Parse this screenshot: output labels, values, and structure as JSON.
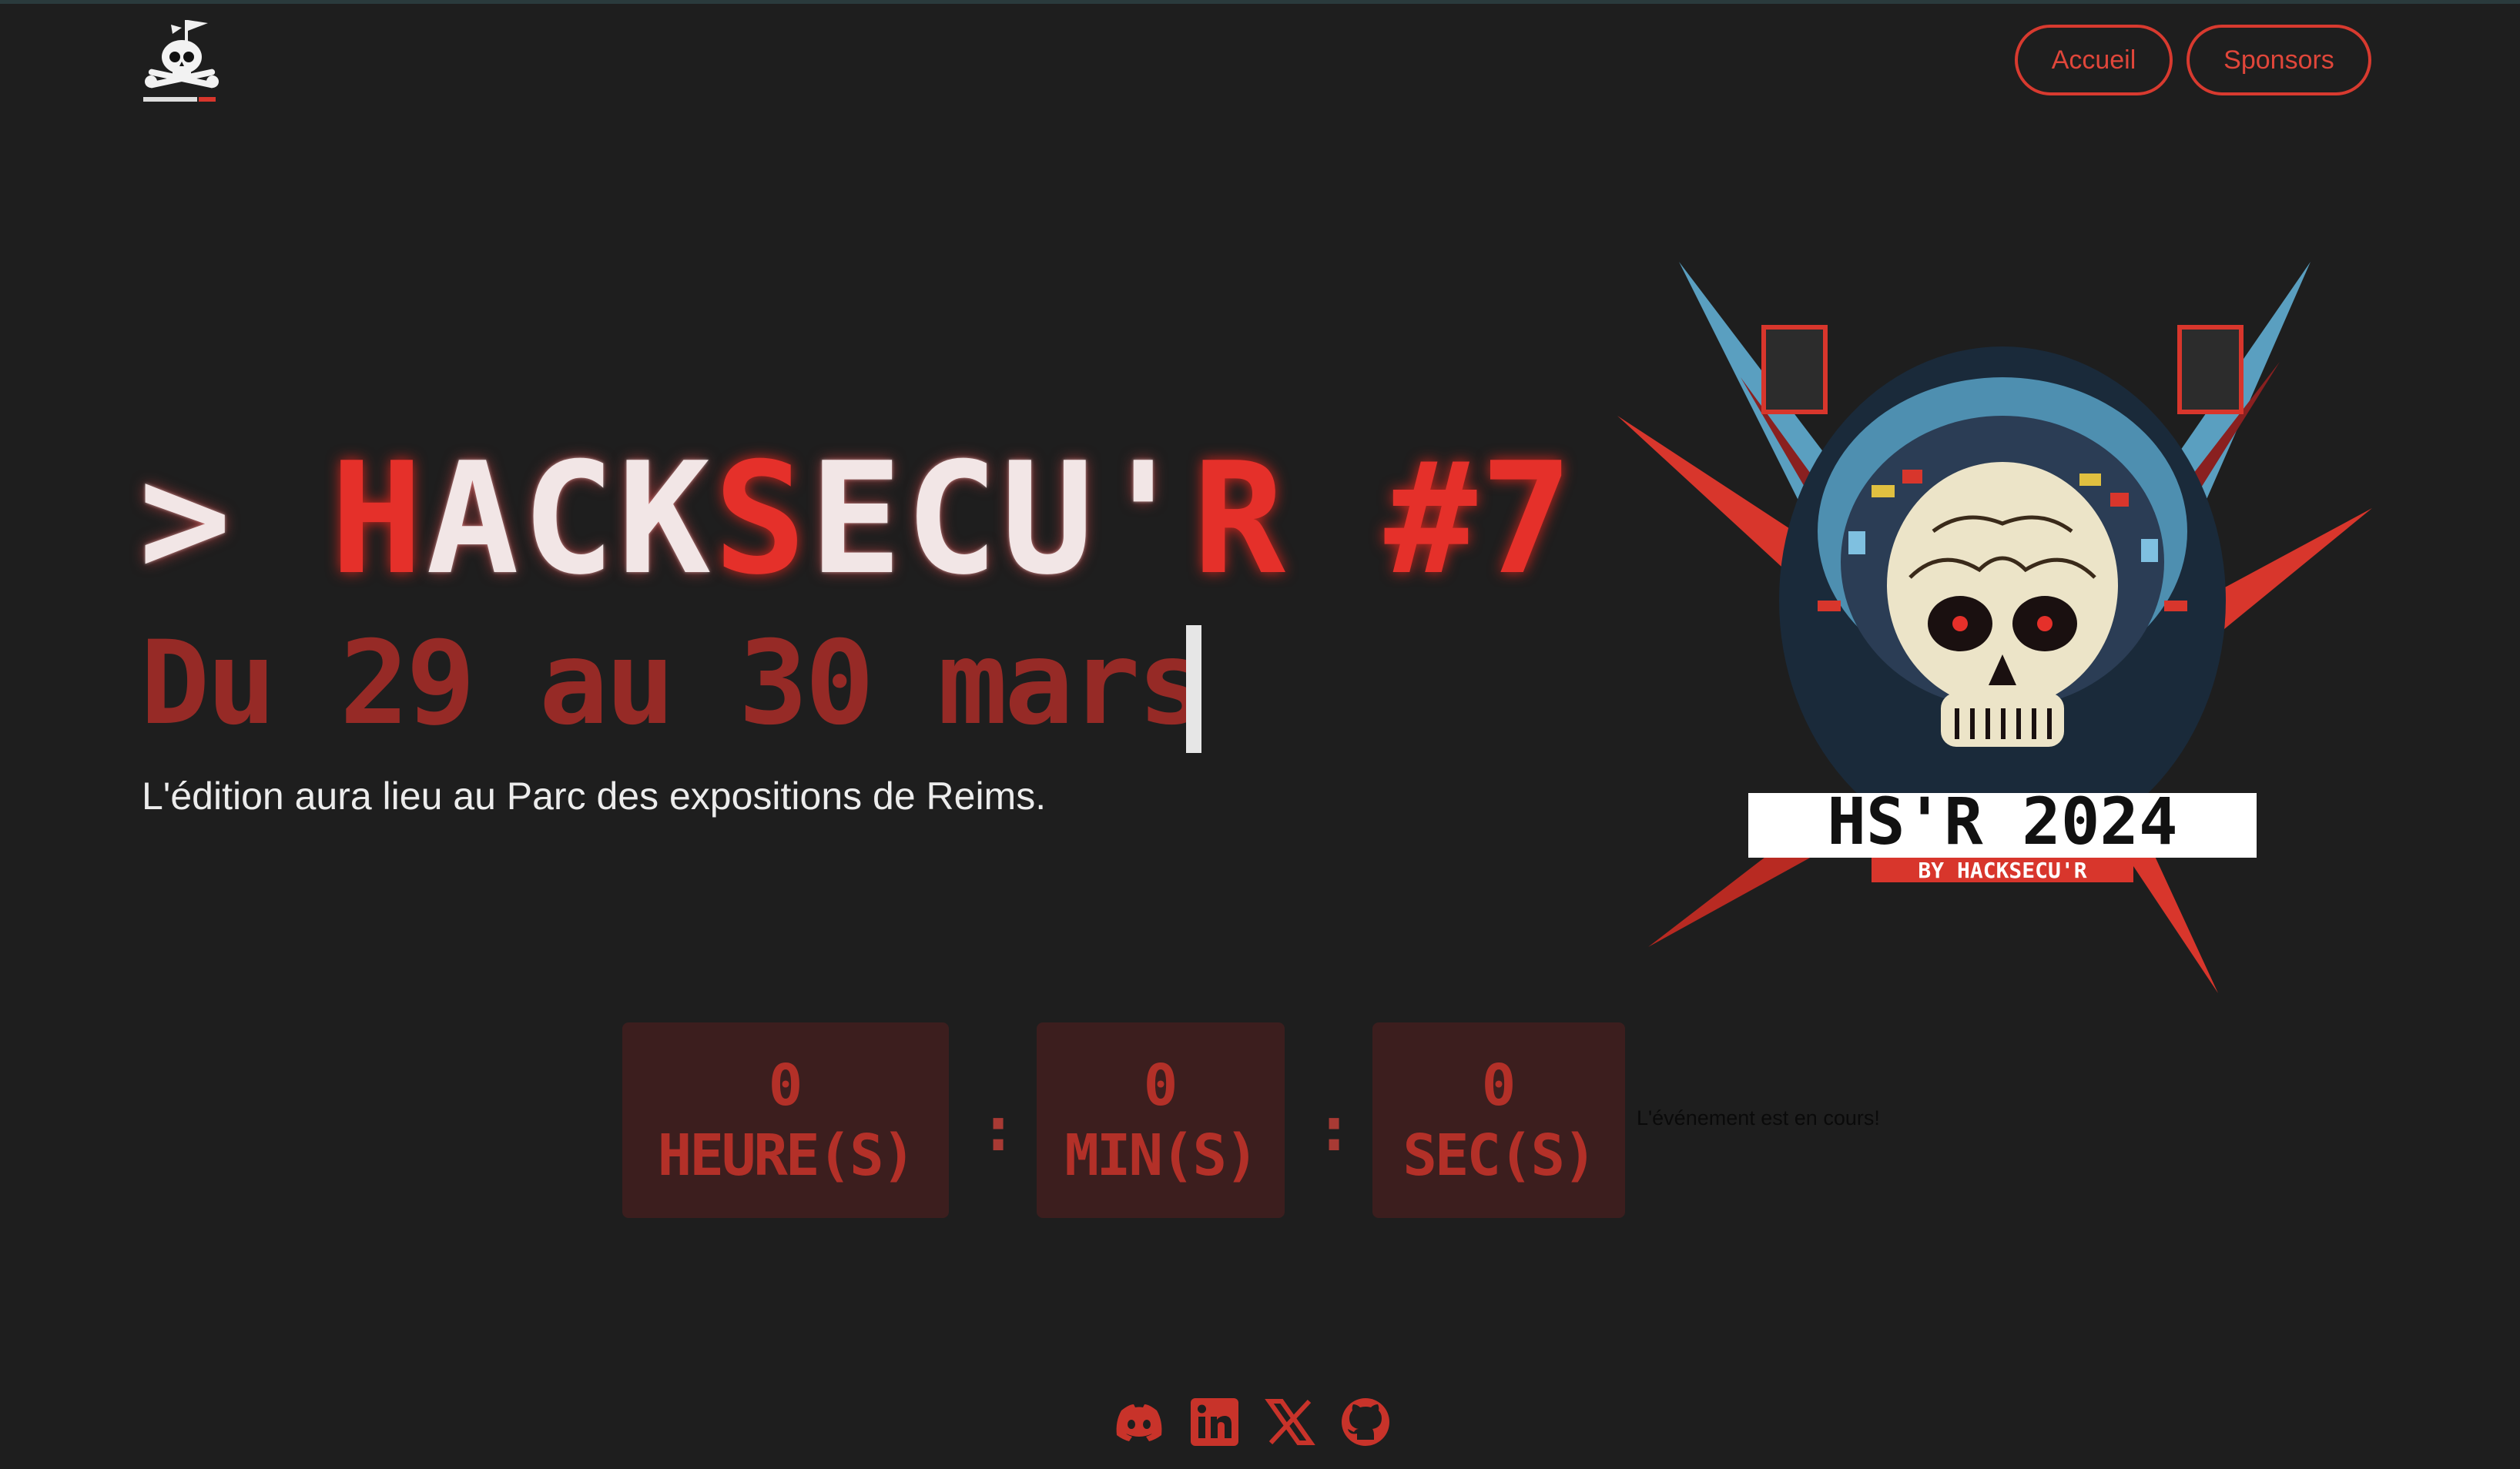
{
  "header": {
    "logo_alt": "HackSecu'R skull logo",
    "nav": [
      {
        "label": "Accueil"
      },
      {
        "label": "Sponsors"
      }
    ]
  },
  "hero": {
    "title_parts": [
      {
        "text": ">",
        "color": "white"
      },
      {
        "text": " ",
        "color": "white"
      },
      {
        "text": "H",
        "color": "red"
      },
      {
        "text": "ACK",
        "color": "white"
      },
      {
        "text": "S",
        "color": "red"
      },
      {
        "text": "ECU'",
        "color": "white"
      },
      {
        "text": "R #7",
        "color": "red"
      }
    ],
    "dates": "Du 29 au 30 mars",
    "subtitle": "L'édition aura lieu au Parc des expositions de Reims.",
    "art_banner": "HS'R 2024",
    "art_sub": "BY HACKSECU'R"
  },
  "countdown": {
    "hours": {
      "value": "0",
      "unit": "HEURE(S)"
    },
    "minutes": {
      "value": "0",
      "unit": "MIN(S)"
    },
    "seconds": {
      "value": "0",
      "unit": "SEC(S)"
    },
    "separator": ":",
    "status": "L'événement est en cours!"
  },
  "social": [
    {
      "icon": "discord-icon"
    },
    {
      "icon": "linkedin-icon"
    },
    {
      "icon": "x-icon"
    },
    {
      "icon": "github-icon"
    }
  ],
  "colors": {
    "background": "#1e1e1e",
    "accent_red": "#e5302a",
    "dim_red": "#962a26",
    "countdown_bg": "#3c1e1e"
  }
}
